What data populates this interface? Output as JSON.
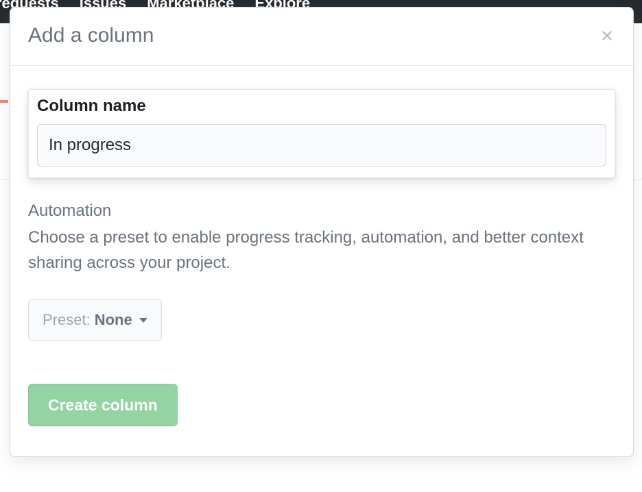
{
  "background_nav": {
    "items": [
      "requests",
      "Issues",
      "Marketplace",
      "Explore"
    ]
  },
  "modal": {
    "title": "Add a column",
    "name_section": {
      "label": "Column name",
      "value": "In progress"
    },
    "automation_section": {
      "heading": "Automation",
      "description": "Choose a preset to enable progress tracking, automation, and better context sharing across your project.",
      "preset_label": "Preset: ",
      "preset_value": "None"
    },
    "create_button_label": "Create column"
  }
}
